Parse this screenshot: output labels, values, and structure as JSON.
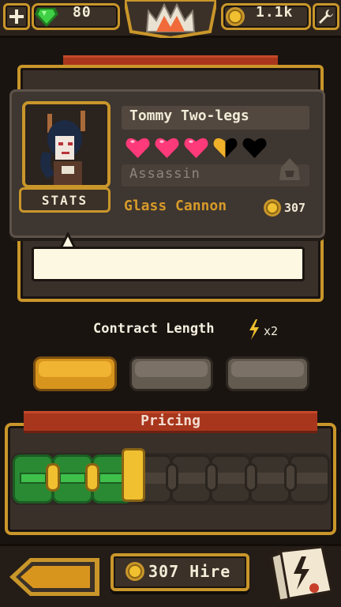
{
  "header": {
    "gems": "80",
    "gold": "1.1k",
    "icons": [
      "plus-icon",
      "gem-icon",
      "crown-icon",
      "coin-icon",
      "wrench-icon"
    ]
  },
  "character": {
    "name": "Tommy Two-legs",
    "class": "Assassin",
    "trait": "Glass Cannon",
    "price": "307",
    "hearts": {
      "full": 3,
      "half": 1,
      "empty": 1,
      "max": 5
    },
    "stats_label": "STATS"
  },
  "speech": {
    "text": ""
  },
  "contract": {
    "label": "Contract Length",
    "multiplier": "x2",
    "options_count": 3,
    "selected_index": 0
  },
  "pricing": {
    "title": "Pricing",
    "total_steps": 8,
    "level": 3
  },
  "footer": {
    "hire_price": "307",
    "hire_label": "Hire"
  },
  "colors": {
    "gold": "#c9962a",
    "banner_red": "#a8361d",
    "heart": "#ff3a7a",
    "slider_green": "#2a9e3a",
    "slider_knob": "#f1c030",
    "trait": "#d79a2a"
  }
}
